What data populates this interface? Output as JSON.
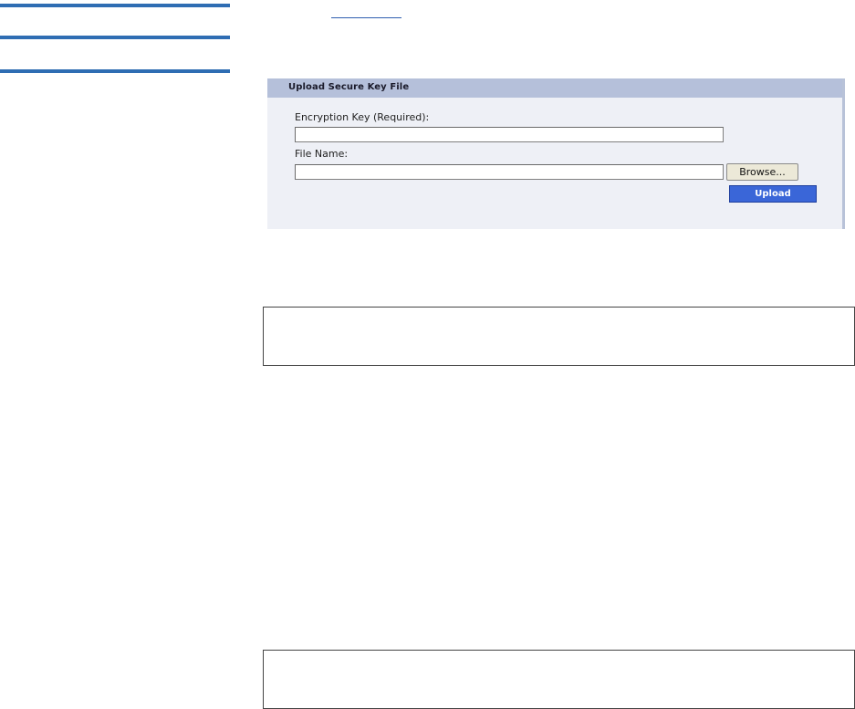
{
  "panel": {
    "title": "Upload Secure Key File",
    "encryption_key_label": "Encryption Key (Required):",
    "encryption_key_value": "",
    "file_name_label": "File Name:",
    "file_name_value": "",
    "browse_label": "Browse...",
    "upload_label": "Upload"
  },
  "colors": {
    "rule_blue": "#2f6db3",
    "panel_background": "#eef0f6",
    "panel_header": "#b5c0da",
    "upload_button": "#3a66d8"
  }
}
